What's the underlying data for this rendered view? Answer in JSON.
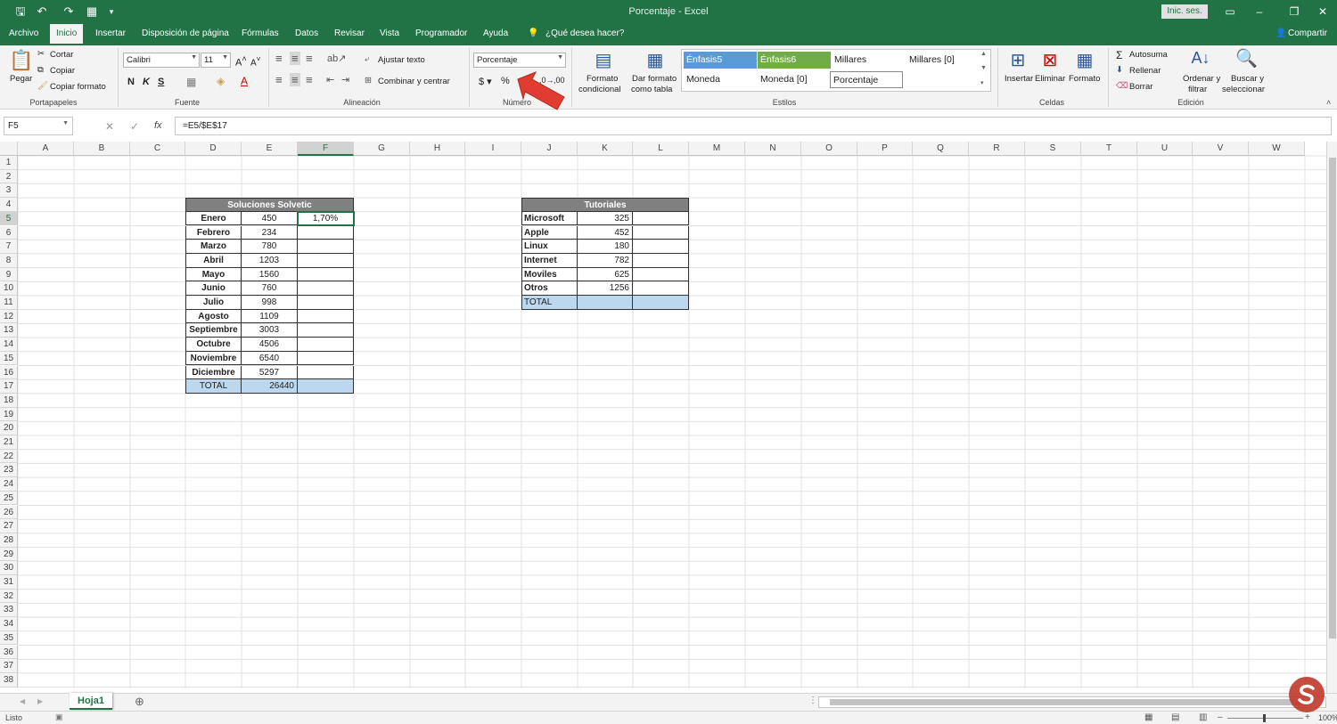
{
  "window": {
    "title": "Porcentaje  -  Excel",
    "signin": "Inic. ses.",
    "share": "Compartir"
  },
  "tabs": [
    "Archivo",
    "Inicio",
    "Insertar",
    "Disposición de página",
    "Fórmulas",
    "Datos",
    "Revisar",
    "Vista",
    "Programador",
    "Ayuda"
  ],
  "tell_me": "¿Qué desea hacer?",
  "ribbon": {
    "clipboard": {
      "paste": "Pegar",
      "cut": "Cortar",
      "copy": "Copiar",
      "format_painter": "Copiar formato",
      "label": "Portapapeles"
    },
    "font": {
      "name": "Calibri",
      "size": "11",
      "bold": "N",
      "italic": "K",
      "underline": "S",
      "label": "Fuente"
    },
    "alignment": {
      "wrap": "Ajustar texto",
      "merge": "Combinar y centrar",
      "label": "Alineación"
    },
    "number": {
      "format": "Porcentaje",
      "label": "Número"
    },
    "styles": {
      "conditional": [
        "Formato",
        "condicional"
      ],
      "table": [
        "Dar formato",
        "como tabla"
      ],
      "cells": [
        "Énfasis5",
        "Énfasis6",
        "Millares",
        "Millares [0]",
        "Moneda",
        "Moneda [0]",
        "Porcentaje"
      ],
      "label": "Estilos"
    },
    "cells": {
      "insert": "Insertar",
      "delete": "Eliminar",
      "format": "Formato",
      "label": "Celdas"
    },
    "editing": {
      "autosum": "Autosuma",
      "fill": "Rellenar",
      "clear": "Borrar",
      "sort": [
        "Ordenar y",
        "filtrar"
      ],
      "find": [
        "Buscar y",
        "seleccionar"
      ],
      "label": "Edición"
    }
  },
  "formula_bar": {
    "name_box": "F5",
    "formula": "=E5/$E$17"
  },
  "columns": [
    "A",
    "B",
    "C",
    "D",
    "E",
    "F",
    "G",
    "H",
    "I",
    "J",
    "K",
    "L",
    "M",
    "N",
    "O",
    "P",
    "Q",
    "R",
    "S",
    "T",
    "U",
    "V",
    "W"
  ],
  "table1": {
    "title": "Soluciones Solvetic",
    "months": [
      "Enero",
      "Febrero",
      "Marzo",
      "Abril",
      "Mayo",
      "Junio",
      "Julio",
      "Agosto",
      "Septiembre",
      "Octubre",
      "Noviembre",
      "Diciembre"
    ],
    "values": [
      "450",
      "234",
      "780",
      "1203",
      "1560",
      "760",
      "998",
      "1109",
      "3003",
      "4506",
      "6540",
      "5297"
    ],
    "percent_first": "1,70%",
    "total_label": "TOTAL",
    "total_value": "26440"
  },
  "table2": {
    "title": "Tutoriales",
    "names": [
      "Microsoft",
      "Apple",
      "Linux",
      "Internet",
      "Moviles",
      "Otros"
    ],
    "values": [
      "325",
      "452",
      "180",
      "782",
      "625",
      "1256"
    ],
    "total_label": "TOTAL"
  },
  "sheet": {
    "tab": "Hoja1"
  },
  "status": {
    "mode": "Listo",
    "zoom": "100%"
  }
}
